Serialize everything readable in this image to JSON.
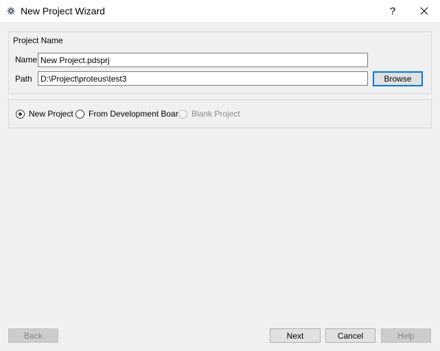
{
  "window": {
    "title": "New Project Wizard",
    "help_label": "?",
    "icon": "proteus-app-icon",
    "close_icon": "close-icon"
  },
  "project_name": {
    "group_title": "Project Name",
    "name_label": "Name",
    "name_value": "New Project.pdsprj",
    "path_label": "Path",
    "path_value": "D:\\Project\\proteus\\test3",
    "browse_label": "Browse"
  },
  "project_type": {
    "options": [
      {
        "label": "New Project",
        "checked": true,
        "enabled": true
      },
      {
        "label": "From Development Board",
        "checked": false,
        "enabled": true
      },
      {
        "label": "Blank Project",
        "checked": false,
        "enabled": false
      }
    ]
  },
  "footer": {
    "back_label": "Back",
    "next_label": "Next",
    "cancel_label": "Cancel",
    "help_label": "Help"
  },
  "colors": {
    "background": "#f0f0f0",
    "titlebar": "#ffffff",
    "focus_border": "#0078d7",
    "disabled_text": "#838383"
  }
}
